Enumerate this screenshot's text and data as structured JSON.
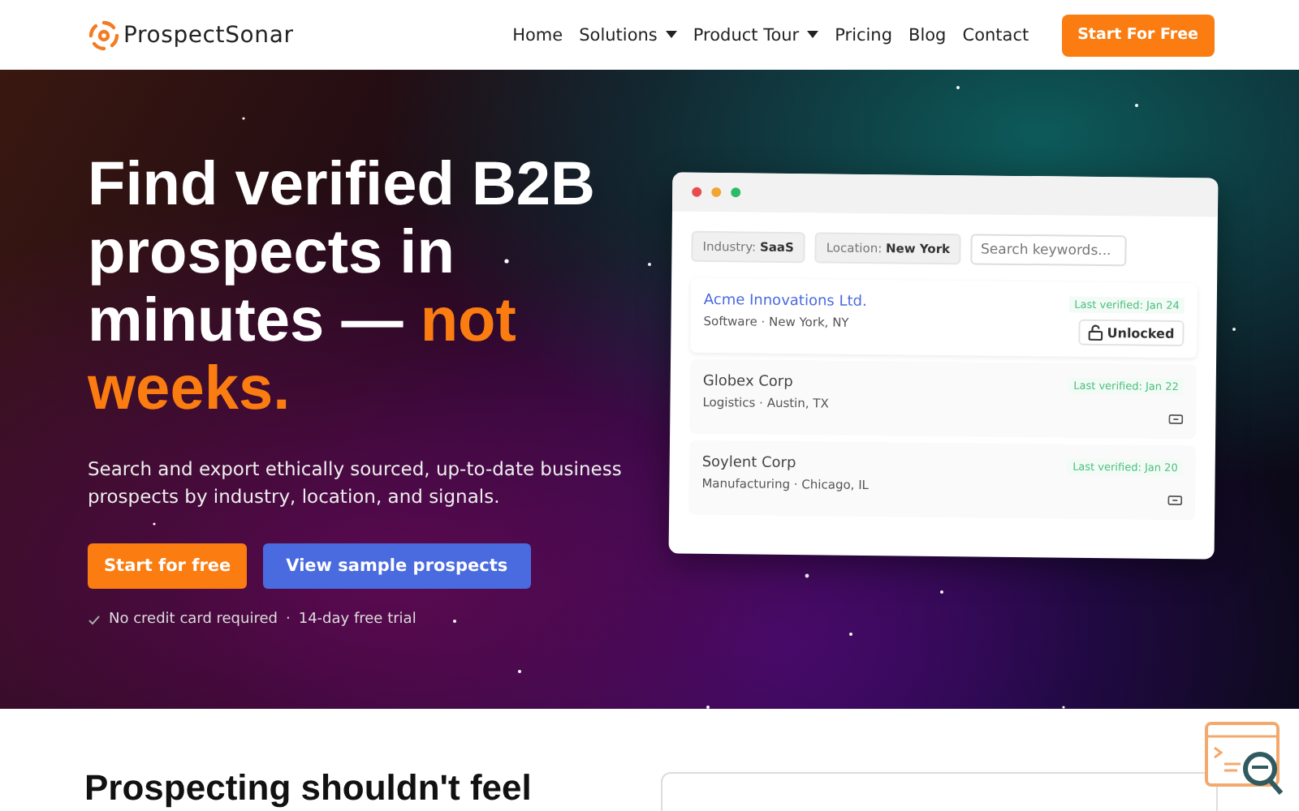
{
  "brand": {
    "name": "ProspectSonar"
  },
  "nav": [
    {
      "label": "Home",
      "has_menu": false
    },
    {
      "label": "Solutions",
      "has_menu": true
    },
    {
      "label": "Product Tour",
      "has_menu": true
    },
    {
      "label": "Pricing",
      "has_menu": false
    },
    {
      "label": "Blog",
      "has_menu": false
    },
    {
      "label": "Contact",
      "has_menu": false
    }
  ],
  "nav_cta": "Start For Free",
  "hero": {
    "headline": "Find verified B2B prospects in minutes —",
    "headline_accent": "not weeks.",
    "subtitle": "Search and export ethically sourced, up-to-date business prospects by industry, location, and signals.",
    "primary_button": "Start for free",
    "secondary_button": "View sample prospects",
    "notes": [
      "No credit card required",
      "14-day free trial"
    ],
    "notes_separator": "·"
  },
  "mockup": {
    "filters": [
      {
        "label": "Industry:",
        "value": "SaaS"
      },
      {
        "label": "Location:",
        "value": "New York"
      }
    ],
    "search": {
      "placeholder": "Search keywords..."
    },
    "prospects": [
      {
        "name": "Acme Innovations Ltd.",
        "details": "Software · New York, NY",
        "verified": "Last verified: Jan 24",
        "unlocked": true,
        "action": "Unlocked"
      },
      {
        "name": "Globex Corp",
        "details": "Logistics · Austin, TX",
        "verified": "Last verified: Jan 22",
        "unlocked": false
      },
      {
        "name": "Soylent Corp",
        "details": "Manufacturing · Chicago, IL",
        "verified": "Last verified: Jan 20",
        "unlocked": false
      }
    ]
  },
  "section": {
    "heading": "Prospecting shouldn't feel"
  }
}
